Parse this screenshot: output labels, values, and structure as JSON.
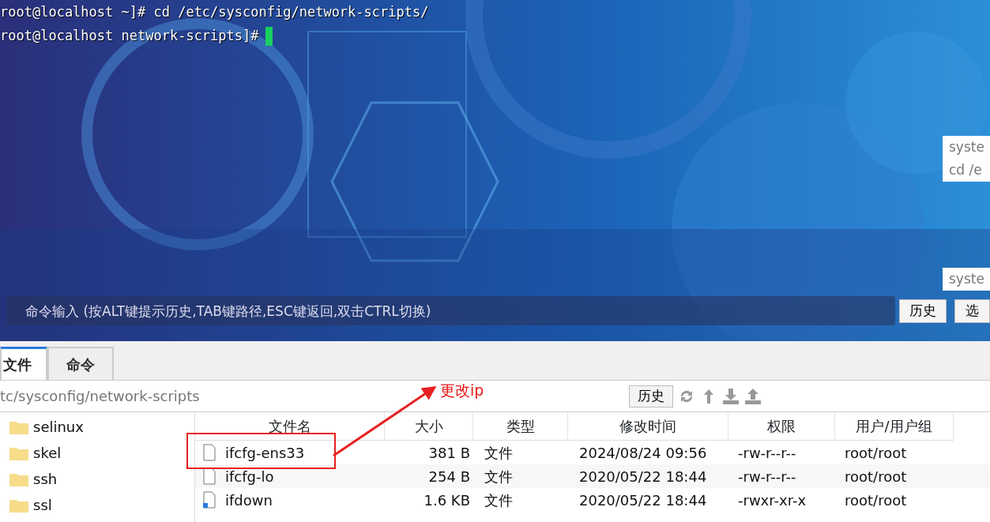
{
  "terminal": {
    "lines": [
      {
        "text": "root@localhost ~]# cd /etc/sysconfig/network-scripts/",
        "cursor": false
      },
      {
        "text": "root@localhost network-scripts]#",
        "cursor": true
      }
    ],
    "suggestions": [
      {
        "lines": [
          "syste",
          "cd /e"
        ]
      },
      {
        "lines": [
          "syste"
        ]
      }
    ],
    "command_input": {
      "placeholder": "命令输入 (按ALT键提示历史,TAB键路径,ESC键返回,双击CTRL切换)"
    },
    "command_buttons": [
      "历史",
      "选"
    ]
  },
  "tabs": [
    {
      "label": "文件",
      "selected": true
    },
    {
      "label": "命令",
      "selected": false
    }
  ],
  "path": {
    "value": "tc/sysconfig/network-scripts"
  },
  "path_button": "历史",
  "toolbar": [
    {
      "kind": "refresh"
    },
    {
      "kind": "up"
    },
    {
      "kind": "download"
    },
    {
      "kind": "upload"
    }
  ],
  "tree": {
    "items": [
      "selinux",
      "skel",
      "ssh",
      "ssl"
    ]
  },
  "table": {
    "columns": [
      "文件名",
      "大小",
      "类型",
      "修改时间",
      "权限",
      "用户/用户组"
    ],
    "rows": [
      {
        "kind": "file",
        "cells": [
          "ifcfg-ens33",
          "381 B",
          "文件",
          "2024/08/24 09:56",
          "-rw-r--r--",
          "root/root"
        ]
      },
      {
        "kind": "file",
        "cells": [
          "ifcfg-lo",
          "254 B",
          "文件",
          "2020/05/22 18:44",
          "-rw-r--r--",
          "root/root"
        ]
      },
      {
        "kind": "script",
        "cells": [
          "ifdown",
          "1.6 KB",
          "文件",
          "2020/05/22 18:44",
          "-rwxr-xr-x",
          "root/root"
        ]
      }
    ]
  },
  "annotation": {
    "text": "更改ip"
  }
}
